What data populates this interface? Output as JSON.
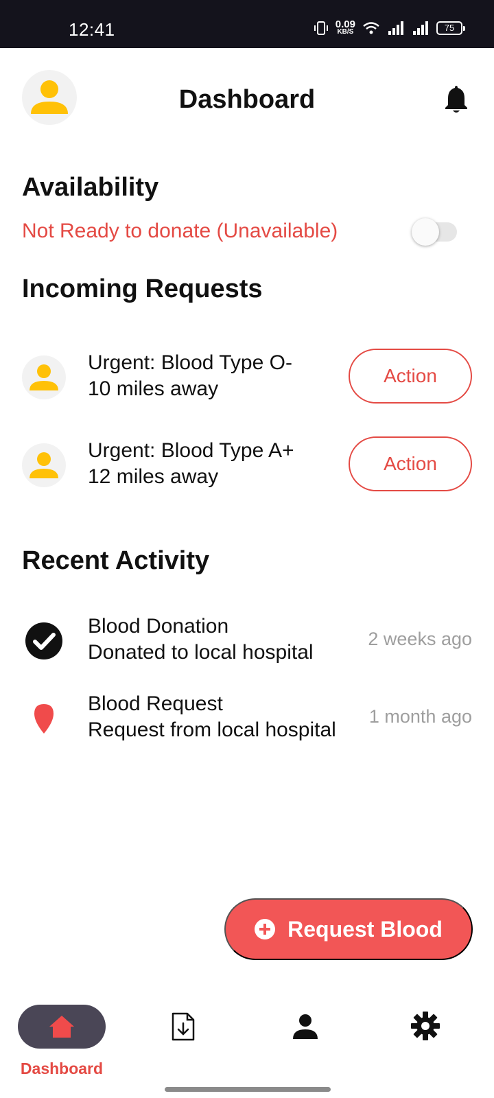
{
  "status_bar": {
    "time": "12:41",
    "net_speed_value": "0.09",
    "net_speed_unit": "KB/S",
    "battery": "75"
  },
  "header": {
    "title": "Dashboard",
    "avatar_icon": "person-icon",
    "notification_icon": "bell-icon"
  },
  "availability": {
    "title": "Availability",
    "status": "Not Ready to donate (Unavailable)",
    "toggle_on": false
  },
  "incoming_requests": {
    "title": "Incoming Requests",
    "items": [
      {
        "line1": "Urgent: Blood Type O-",
        "line2": "10 miles away",
        "action": "Action"
      },
      {
        "line1": "Urgent: Blood Type A+",
        "line2": "12 miles away",
        "action": "Action"
      }
    ]
  },
  "recent_activity": {
    "title": "Recent Activity",
    "items": [
      {
        "title": "Blood Donation",
        "subtitle": "Donated to local hospital",
        "time": "2 weeks ago",
        "icon": "check-circle-icon"
      },
      {
        "title": "Blood Request",
        "subtitle": "Request from local hospital",
        "time": "1 month ago",
        "icon": "location-pin-icon"
      }
    ]
  },
  "fab": {
    "label": "Request Blood",
    "icon": "plus-circle-icon"
  },
  "bottom_nav": {
    "items": [
      {
        "label": "Dashboard",
        "icon": "home-icon",
        "active": true
      },
      {
        "label": "",
        "icon": "download-document-icon",
        "active": false
      },
      {
        "label": "",
        "icon": "person-icon",
        "active": false
      },
      {
        "label": "",
        "icon": "gear-icon",
        "active": false
      }
    ]
  },
  "colors": {
    "accent": "#e44a44",
    "fab": "#f25656",
    "avatar": "#ffc107",
    "status_bar": "#14131c",
    "nav_active_pill": "#4a4656"
  }
}
